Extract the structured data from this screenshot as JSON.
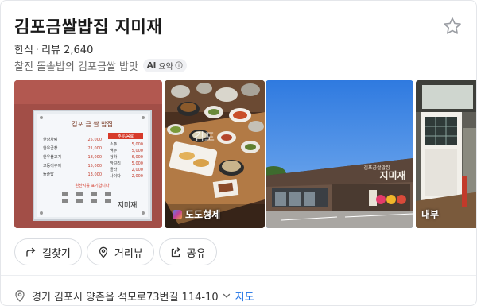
{
  "place": {
    "name": "김포금쌀밥집 지미재",
    "category": "한식",
    "review_label": "리뷰",
    "review_count": "2,640",
    "summary": "찰진 돌솥밥의 김포금쌀 밥맛",
    "ai_badge": {
      "ai": "AI",
      "label": "요약"
    }
  },
  "photos": [
    {
      "name": "menu-board",
      "menu_title": "김포 금 쌀 밥집",
      "menu_items": [
        "한상차림",
        "한우곱창",
        "한우불고기",
        "고등어구이",
        "돌솥밥"
      ],
      "menu_prices": [
        "25,000",
        "21,000",
        "18,000",
        "15,000",
        "13,000"
      ],
      "menu_side_header": "주류/음료",
      "menu_side_items": [
        "소주",
        "맥주",
        "청하",
        "막걸리",
        "콜라",
        "사이다"
      ],
      "menu_side_prices": [
        "5,000",
        "5,000",
        "6,000",
        "5,000",
        "2,000",
        "2,000"
      ],
      "menu_footer": "원산지를 표기합니다",
      "menu_brand": "지미재",
      "label": ""
    },
    {
      "name": "food-table",
      "watermark": "김포",
      "label": "도도형제"
    },
    {
      "name": "building-exterior",
      "sign_small": "김포금쌀밥집",
      "sign_big": "지미재",
      "label": ""
    },
    {
      "name": "interior",
      "label": "내부"
    }
  ],
  "actions": {
    "directions": "길찾기",
    "distance_view": "거리뷰",
    "share": "공유"
  },
  "address": {
    "text": "경기 김포시 양촌읍 석모로73번길 114-10",
    "map_link": "지도"
  },
  "colors": {
    "link": "#1a6fe6",
    "title": "#1a1a1a",
    "border": "#d9dce1"
  }
}
